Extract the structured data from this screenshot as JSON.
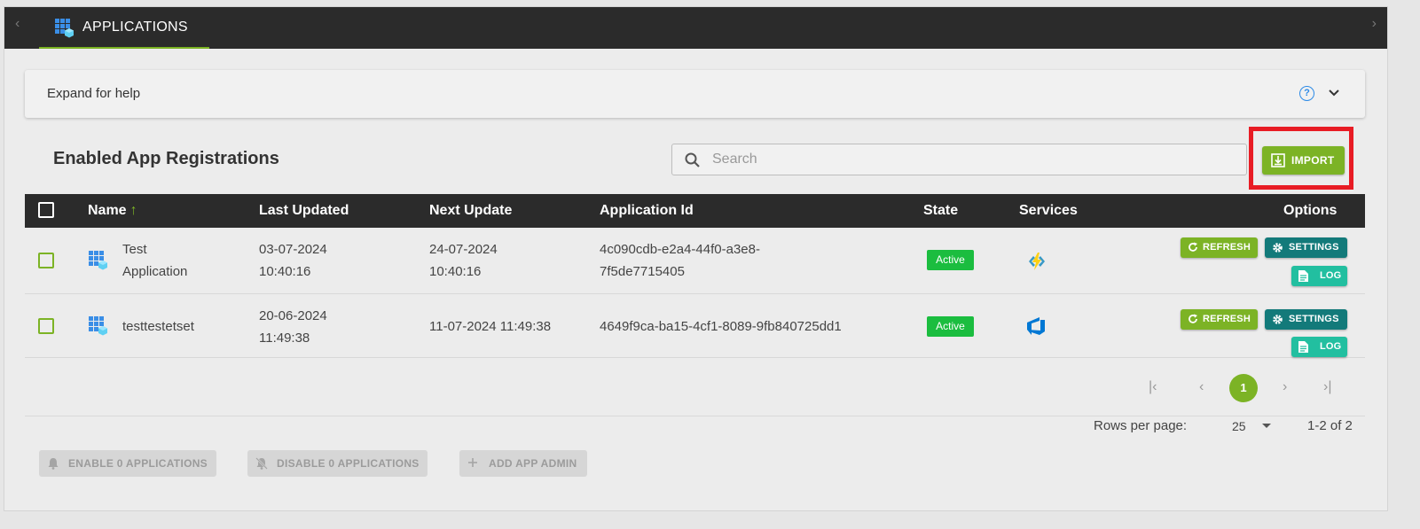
{
  "tabbar": {
    "tab_label": "APPLICATIONS",
    "left_arrow": "‹",
    "right_arrow": "›",
    "tab_icon": "grid-cube-icon",
    "accent": "#7bb222"
  },
  "help": {
    "label": "Expand for help",
    "question_icon": "?",
    "chevron_icon": "chevron-down-icon"
  },
  "section": {
    "title": "Enabled App Registrations",
    "search_placeholder": "Search",
    "search_value": "",
    "import_label": "IMPORT"
  },
  "table": {
    "columns": {
      "name": "Name",
      "sort_arrow": "↑",
      "last_updated": "Last Updated",
      "next_update": "Next Update",
      "application_id": "Application Id",
      "state": "State",
      "services": "Services",
      "options": "Options"
    },
    "rows": [
      {
        "name_line1": "Test",
        "name_line2": "Application",
        "last_updated_line1": "03-07-2024",
        "last_updated_line2": "10:40:16",
        "next_update_line1": "24-07-2024",
        "next_update_line2": "10:40:16",
        "app_id_line1": "4c090cdb-e2a4-44f0-a3e8-",
        "app_id_line2": "7f5de7715405",
        "state": "Active",
        "service_icon": "azure-function-icon"
      },
      {
        "name_line1": "testtestetset",
        "last_updated_line1": "20-06-2024",
        "last_updated_line2": "11:49:38",
        "next_update_line1": "11-07-2024 11:49:38",
        "app_id_line1": "4649f9ca-ba15-4cf1-8089-9fb840725dd1",
        "state": "Active",
        "service_icon": "azure-devops-icon"
      }
    ],
    "options": {
      "refresh": "REFRESH",
      "settings": "SETTINGS",
      "log": "LOG"
    }
  },
  "pagination": {
    "first": "|‹",
    "prev": "‹",
    "current_page": "1",
    "next": "›",
    "last": "›|",
    "rows_per_page_label": "Rows per page:",
    "rows_per_page_value": "25",
    "range": "1-2 of 2"
  },
  "actions": {
    "enable": "ENABLE 0 APPLICATIONS",
    "disable": "DISABLE 0 APPLICATIONS",
    "add_admin": "ADD APP ADMIN"
  },
  "colors": {
    "brand_green": "#7cb325",
    "teal": "#137a7a",
    "mint": "#22bfa0",
    "active_badge": "#1bbd3f",
    "highlight_red": "#e81c24",
    "dark_header": "#2b2b2b"
  }
}
